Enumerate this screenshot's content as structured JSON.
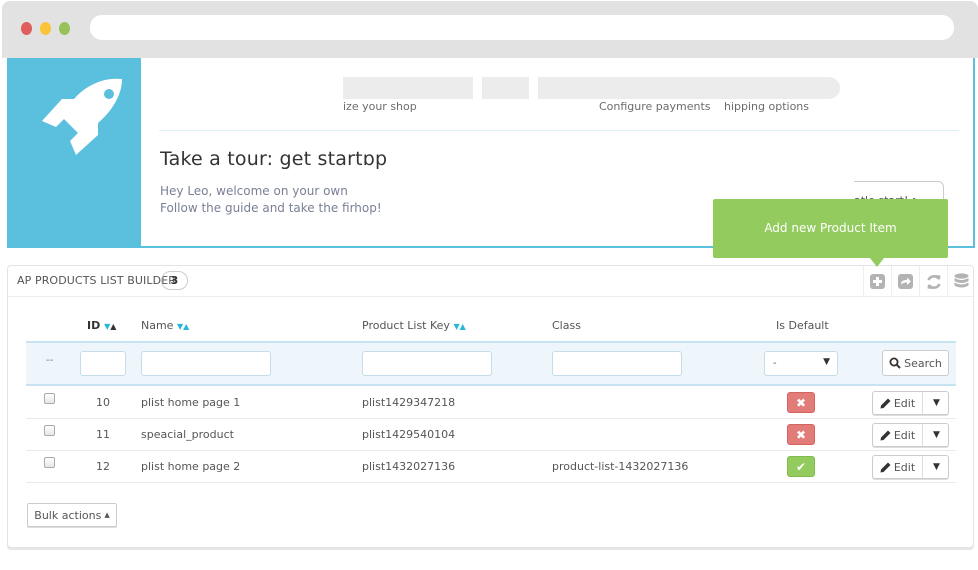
{
  "browser": {
    "address_value": ""
  },
  "banner": {
    "step_labels": [
      "ize your shop",
      "Configure payments",
      "hipping options"
    ],
    "title": "Take a tour: get startɒp",
    "line1": "Hey Leo, welcome on your own",
    "line2": "Follow the guide and take the firhop!",
    "start_button": "atle start! >",
    "accent_color": "#5bbfde"
  },
  "tooltip": {
    "text": "Add new Product Item",
    "color": "#93cb5f"
  },
  "panel": {
    "title": "AP PRODUCTS LIST BUILDER",
    "count": "3",
    "toolbar": [
      {
        "name": "add-new-icon",
        "label": "Add new"
      },
      {
        "name": "export-icon",
        "label": "Export"
      },
      {
        "name": "refresh-icon",
        "label": "Refresh list"
      },
      {
        "name": "sql-query-icon",
        "label": "Show SQL query"
      }
    ]
  },
  "table": {
    "columns": {
      "id": "ID",
      "name": "Name",
      "key": "Product List Key",
      "class": "Class",
      "is_default": "Is Default"
    },
    "filters": {
      "placeholder_dash": "--",
      "id": "",
      "name": "",
      "key": "",
      "class": "",
      "is_default_selected": "-",
      "search_label": "Search"
    },
    "rows": [
      {
        "id": "10",
        "name": "plist home page 1",
        "key": "plist1429347218",
        "class": "",
        "is_default": false,
        "action": "Edit"
      },
      {
        "id": "11",
        "name": "speacial_product",
        "key": "plist1429540104",
        "class": "",
        "is_default": false,
        "action": "Edit"
      },
      {
        "id": "12",
        "name": "plist home page 2",
        "key": "plist1432027136",
        "class": "product-list-1432027136",
        "is_default": true,
        "action": "Edit"
      }
    ]
  },
  "footer": {
    "bulk_actions": "Bulk actions"
  },
  "icons": {
    "yes": "✔",
    "no": "✖",
    "caret_down": "▼",
    "caret_up": "▲"
  }
}
